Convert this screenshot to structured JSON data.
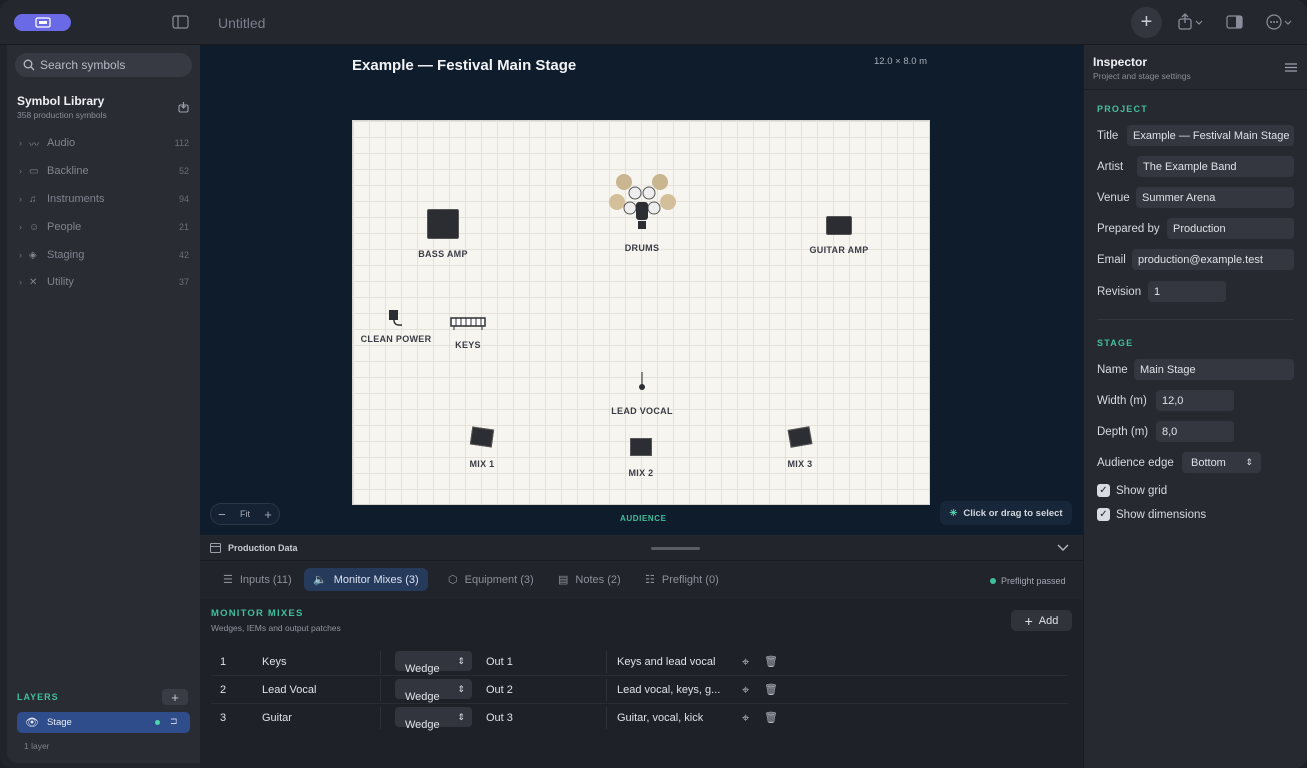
{
  "app": {
    "title": "Untitled"
  },
  "sidebar": {
    "search_placeholder": "Search symbols",
    "library_title": "Symbol Library",
    "library_sub": "358 production symbols",
    "categories": [
      {
        "label": "Audio",
        "count": "112",
        "icon": "waveform-icon"
      },
      {
        "label": "Backline",
        "count": "52",
        "icon": "amp-icon"
      },
      {
        "label": "Instruments",
        "count": "94",
        "icon": "instruments-icon"
      },
      {
        "label": "People",
        "count": "21",
        "icon": "people-icon"
      },
      {
        "label": "Staging",
        "count": "42",
        "icon": "layers-icon"
      },
      {
        "label": "Utility",
        "count": "37",
        "icon": "tools-icon"
      }
    ],
    "layers_title": "LAYERS",
    "layer_name": "Stage",
    "layer_count": "1 layer"
  },
  "canvas": {
    "title": "Example — Festival Main Stage",
    "dims": "12.0 × 8.0 m",
    "audience": "AUDIENCE",
    "zoom_fit": "Fit",
    "hint": "Click or drag to select",
    "symbols": {
      "bass_amp": "BASS AMP",
      "drums": "DRUMS",
      "guitar_amp": "GUITAR AMP",
      "clean_power": "CLEAN POWER",
      "keys": "KEYS",
      "lead_vocal": "LEAD VOCAL",
      "mix1": "MIX 1",
      "mix2": "MIX 2",
      "mix3": "MIX 3"
    }
  },
  "inspector": {
    "title": "Inspector",
    "subtitle": "Project and stage settings",
    "project_h": "PROJECT",
    "fields": {
      "title_l": "Title",
      "title_v": "Example — Festival Main Stage",
      "artist_l": "Artist",
      "artist_v": "The Example Band",
      "venue_l": "Venue",
      "venue_v": "Summer Arena",
      "prepared_l": "Prepared by",
      "prepared_v": "Production",
      "email_l": "Email",
      "email_v": "production@example.test",
      "rev_l": "Revision",
      "rev_v": "1"
    },
    "stage_h": "STAGE",
    "stage": {
      "name_l": "Name",
      "name_v": "Main Stage",
      "width_l": "Width (m)",
      "width_v": "12,0",
      "depth_l": "Depth (m)",
      "depth_v": "8,0",
      "edge_l": "Audience edge",
      "edge_v": "Bottom",
      "grid_l": "Show grid",
      "dims_l": "Show dimensions"
    }
  },
  "panel": {
    "title": "Production Data",
    "tabs": [
      "Inputs (11)",
      "Monitor Mixes (3)",
      "Equipment (3)",
      "Notes (2)",
      "Preflight (0)"
    ],
    "preflight": "Preflight passed",
    "mm_title": "MONITOR MIXES",
    "mm_sub": "Wedges, IEMs and output patches",
    "add": "Add",
    "rows": [
      {
        "n": "1",
        "name": "Keys",
        "type": "Wedge",
        "out": "Out 1",
        "content": "Keys and lead vocal"
      },
      {
        "n": "2",
        "name": "Lead Vocal",
        "type": "Wedge",
        "out": "Out 2",
        "content": "Lead vocal, keys, g..."
      },
      {
        "n": "3",
        "name": "Guitar",
        "type": "Wedge",
        "out": "Out 3",
        "content": "Guitar, vocal, kick"
      }
    ]
  }
}
